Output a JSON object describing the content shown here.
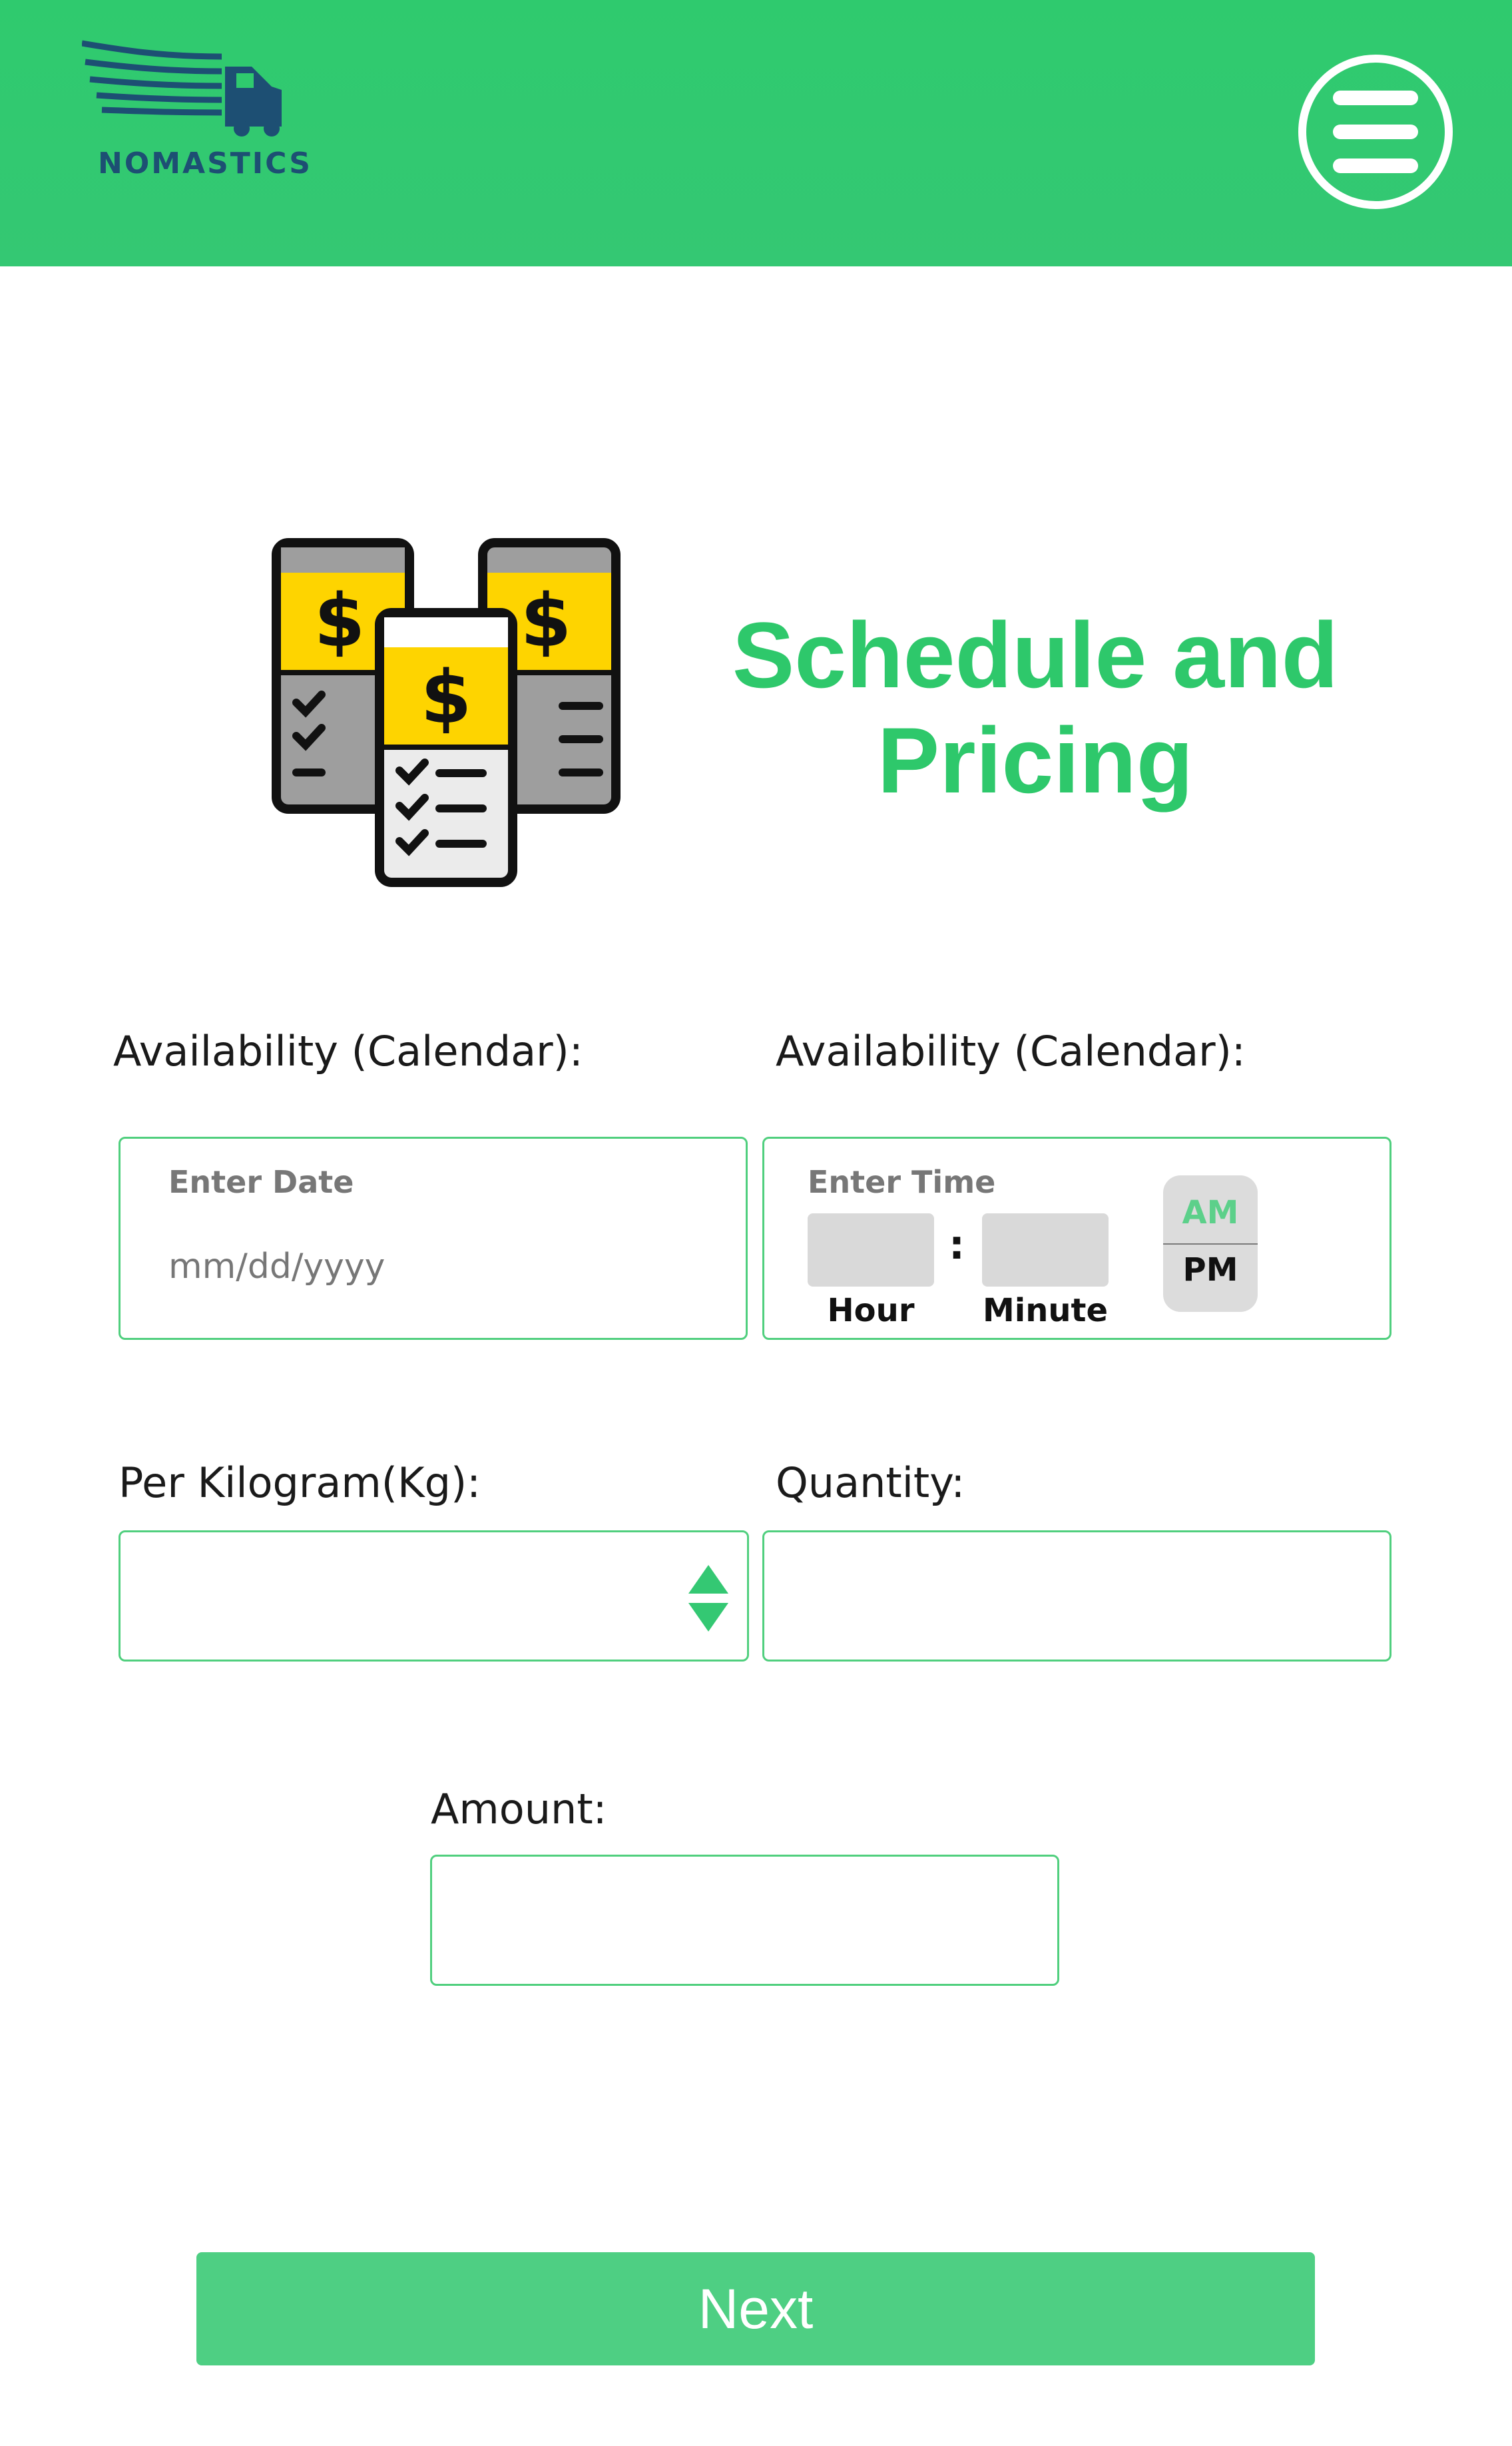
{
  "header": {
    "brand": "NOMASTICS",
    "tagline": "",
    "menu_icon": "hamburger-menu-icon",
    "background": "#2fca6e"
  },
  "hero": {
    "icon": "price-list-documents-icon",
    "title_line1": "Schedule and",
    "title_line2": "Pricing",
    "title_color": "#2ec86b"
  },
  "form": {
    "date": {
      "label": "Availability (Calendar):",
      "inner_label": "Enter Date",
      "placeholder": "mm/dd/yyyy"
    },
    "time": {
      "label": "Availability (Calendar):",
      "inner_label": "Enter Time",
      "hour_label": "Hour",
      "minute_label": "Minute",
      "separator": ":",
      "am": "AM",
      "pm": "PM",
      "selected_period": "PM"
    },
    "per_kg": {
      "label": "Per Kilogram(Kg):",
      "value": ""
    },
    "quantity": {
      "label": "Quantity:",
      "value": ""
    },
    "amount": {
      "label": "Amount:",
      "value": ""
    }
  },
  "footer": {
    "next_label": "Next",
    "button_color": "#4ecf83"
  },
  "colors": {
    "accent": "#2ec86b",
    "border": "#50cf7e"
  }
}
